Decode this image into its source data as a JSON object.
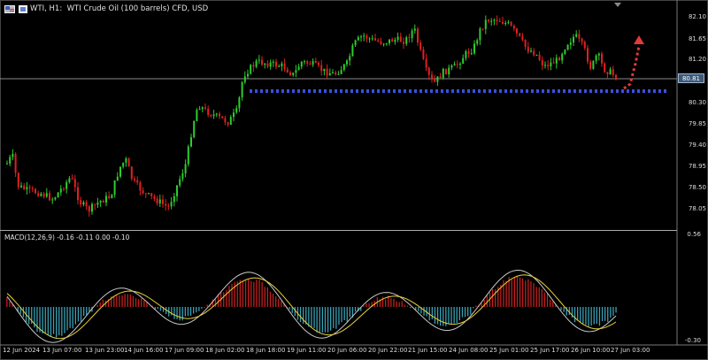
{
  "header": {
    "symbol": "WTI",
    "timeframe": "H1",
    "description": "WTI Crude Oil (100 barrels) CFD, USD"
  },
  "price_axis": {
    "labels": [
      "82.10",
      "81.65",
      "81.20",
      "80.30",
      "79.85",
      "79.40",
      "78.95",
      "78.50",
      "78.05"
    ],
    "current_price": "80.81"
  },
  "macd": {
    "label": "MACD(12,26,9) -0.16 -0.11 0.00 -0.10",
    "scale_top": "0.56",
    "scale_bottom": "-0.30"
  },
  "time_axis": {
    "labels": [
      "12 Jun 2024",
      "13 Jun 07:00",
      "13 Jun 23:00",
      "14 Jun 16:00",
      "17 Jun 09:00",
      "18 Jun 02:00",
      "18 Jun 18:00",
      "19 Jun 11:00",
      "20 Jun 06:00",
      "20 Jun 22:00",
      "21 Jun 15:00",
      "24 Jun 08:00",
      "25 Jun 01:00",
      "25 Jun 17:00",
      "26 Jun 10:00",
      "27 Jun 03:00"
    ]
  },
  "colors": {
    "bull": "#2ecc2e",
    "bear": "#e02020",
    "support_line": "#3a4fe0",
    "projection_arrow": "#e03a3a",
    "macd_signal": "#e8d23a",
    "macd_line": "#c8c8c8"
  }
}
